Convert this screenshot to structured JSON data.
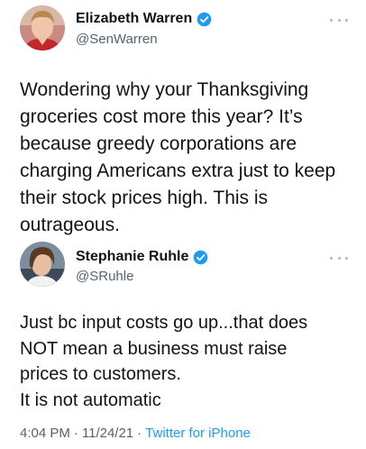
{
  "tweet": {
    "author_name": "Elizabeth Warren",
    "author_handle": "@SenWarren",
    "text": "Wondering why your Thanksgiving\ngroceries cost more this year? It’s\nbecause greedy corporations are\ncharging Americans extra just to keep\ntheir stock prices high. This is\noutrageous."
  },
  "quoted_tweet": {
    "author_name": "Stephanie Ruhle",
    "author_handle": "@SRuhle",
    "text": "Just bc input costs go up...that does\nNOT mean a business must raise\nprices to customers.\nIt is not automatic"
  },
  "footer": {
    "time": "4:04 PM",
    "separator": "·",
    "date": "11/24/21",
    "source": "Twitter for iPhone"
  },
  "icons": [
    "verified-badge-icon",
    "more-options-icon"
  ],
  "colors": {
    "text": "#0f1419",
    "secondary": "#536471",
    "accent": "#1d9bf0"
  }
}
